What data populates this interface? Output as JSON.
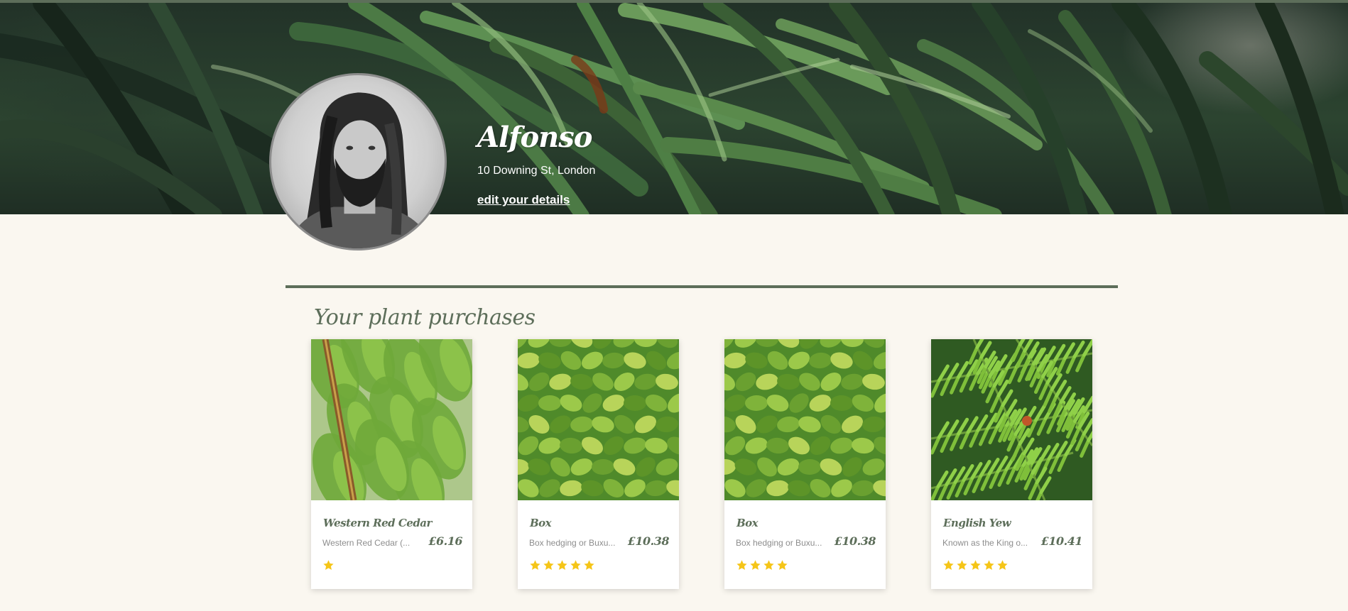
{
  "profile": {
    "name": "Alfonso",
    "address": "10 Downing St, London",
    "edit_link": "edit your details"
  },
  "section": {
    "title": "Your plant purchases"
  },
  "colors": {
    "accent": "#5d6e5a",
    "background": "#faf7f0",
    "star": "#f5c518"
  },
  "purchases": [
    {
      "name": "Western Red Cedar",
      "description": "Western Red Cedar (...",
      "price": "£6.16",
      "rating": 1,
      "image_icon": "cedar-foliage-icon"
    },
    {
      "name": "Box",
      "description": "Box hedging or Buxu...",
      "price": "£10.38",
      "rating": 5,
      "image_icon": "box-shrub-icon"
    },
    {
      "name": "Box",
      "description": "Box hedging or Buxu...",
      "price": "£10.38",
      "rating": 4,
      "image_icon": "box-shrub-icon"
    },
    {
      "name": "English Yew",
      "description": "Known as the King o...",
      "price": "£10.41",
      "rating": 5,
      "image_icon": "yew-needles-icon"
    }
  ]
}
